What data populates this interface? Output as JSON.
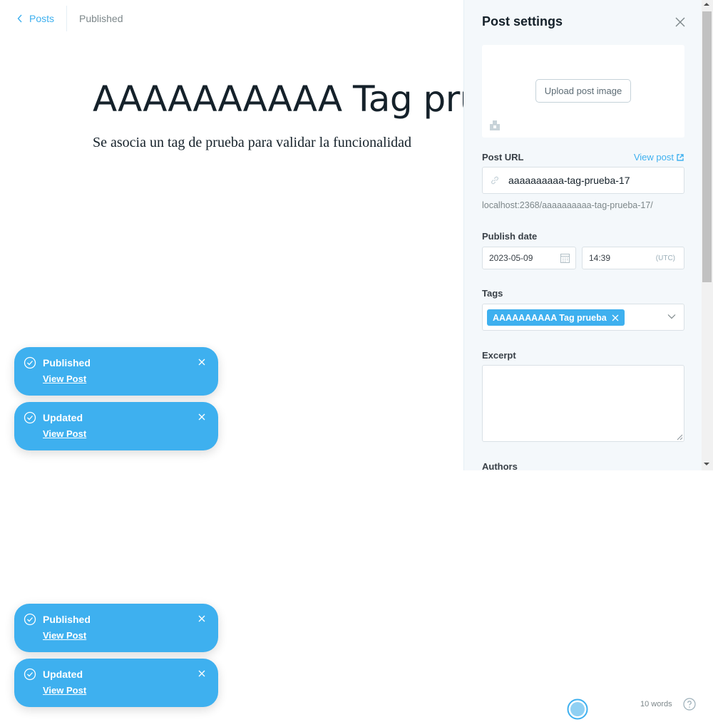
{
  "breadcrumb": {
    "back_label": "Posts",
    "status": "Published"
  },
  "post": {
    "title": "AAAAAAAAAA Tag prueba",
    "body": "Se asocia un tag de prueba para validar la funcionalidad"
  },
  "settings": {
    "title": "Post settings",
    "upload_label": "Upload post image",
    "post_url_label": "Post URL",
    "view_post_label": "View post",
    "slug_value": "aaaaaaaaaa-tag-prueba-17",
    "url_hint": "localhost:2368/aaaaaaaaaa-tag-prueba-17/",
    "publish_date_label": "Publish date",
    "date_value": "2023-05-09",
    "time_value": "14:39",
    "timezone": "(UTC)",
    "tags_label": "Tags",
    "tags": [
      "AAAAAAAAAA Tag prueba"
    ],
    "excerpt_label": "Excerpt",
    "excerpt_value": "",
    "authors_label": "Authors"
  },
  "toasts": [
    {
      "title": "Published",
      "link": "View Post"
    },
    {
      "title": "Updated",
      "link": "View Post"
    },
    {
      "title": "Published",
      "link": "View Post"
    },
    {
      "title": "Updated",
      "link": "View Post"
    }
  ],
  "footer": {
    "word_count": "10 words"
  },
  "colors": {
    "accent": "#3eb0ef",
    "panel_bg": "#f4f8fb",
    "text": "#15212a",
    "muted": "#7d878a"
  },
  "icons": {
    "back": "chevron-left-icon",
    "close": "close-icon",
    "image": "image-icon",
    "link": "link-icon",
    "external": "external-link-icon",
    "calendar": "calendar-icon",
    "chevron": "chevron-down-icon",
    "check": "check-circle-icon",
    "help": "help-icon"
  }
}
